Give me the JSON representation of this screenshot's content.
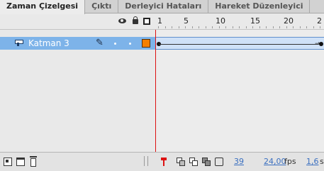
{
  "tabs": [
    {
      "label": "Zaman Çizelgesi"
    },
    {
      "label": "Çıktı"
    },
    {
      "label": "Derleyici Hataları"
    },
    {
      "label": "Hareket Düzenleyici"
    }
  ],
  "ruler": {
    "labels": [
      "1",
      "5",
      "10",
      "15",
      "20",
      "2"
    ]
  },
  "layers": [
    {
      "name": "Katman 3",
      "color": "#f57f00"
    }
  ],
  "status": {
    "current_frame": "39",
    "frame_rate": "24,00",
    "fps_unit": "fps",
    "elapsed_time": "1,6",
    "elapsed_unit": "s"
  },
  "colors": {
    "selected_row": "#7db3e9",
    "playhead": "#dd1111",
    "layer_outline_color": "#f57f00"
  }
}
